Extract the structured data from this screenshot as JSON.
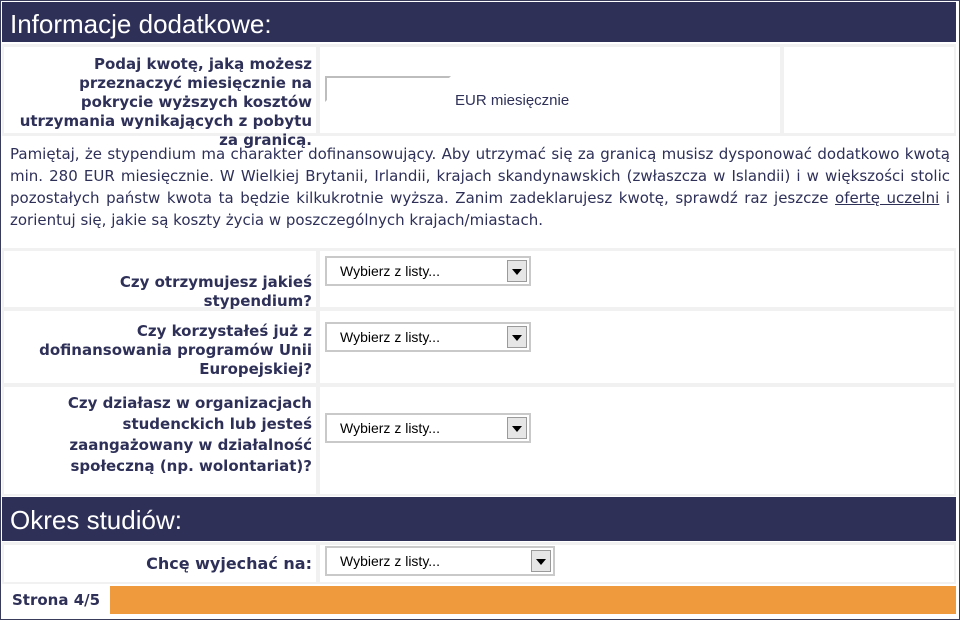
{
  "sections": {
    "additional_info": {
      "title": "Informacje dodatkowe:"
    },
    "study_period": {
      "title": "Okres studiów:"
    }
  },
  "amount": {
    "question": "Podaj kwotę, jaką możesz przeznaczyć miesięcznie na pokrycie wyższych kosztów utrzymania wynikających z pobytu za granicą.",
    "value": "",
    "unit": "EUR miesięcznie"
  },
  "info": {
    "text_before_link": "Pamiętaj, że stypendium ma charakter dofinansowujący. Aby utrzymać się za granicą musisz dysponować dodatkowo kwotą min. 280 EUR miesięcznie. W Wielkiej Brytanii, Irlandii, krajach skandynawskich (zwłaszcza w Islandii) i w większości stolic pozostałych państw kwota ta będzie kilkukrotnie wyższa. Zanim zadeklarujesz kwotę, sprawdź raz jeszcze",
    "link_text": "ofertę uczelni",
    "text_after_link": "i zorientuj się, jakie są koszty życia w poszczególnych krajach/miastach."
  },
  "questions": [
    {
      "label": "Czy otrzymujesz jakieś stypendium?",
      "selected": "Wybierz z listy..."
    },
    {
      "label": "Czy korzystałeś już z dofinansowania programów Unii Europejskiej?",
      "selected": "Wybierz z listy..."
    },
    {
      "label": "Czy działasz w organizacjach studenckich lub jesteś zaangażowany w działalność społeczną (np. wolontariat)?",
      "selected": "Wybierz z listy..."
    }
  ],
  "departure": {
    "label": "Chcę wyjechać na:",
    "selected": "Wybierz z listy..."
  },
  "footer": {
    "page": "Strona 4/5"
  },
  "colors": {
    "header_bg": "#2e3058",
    "text": "#2e3058",
    "footer_bar": "#ef9a3c",
    "panel_bg": "#f1f1f1"
  }
}
